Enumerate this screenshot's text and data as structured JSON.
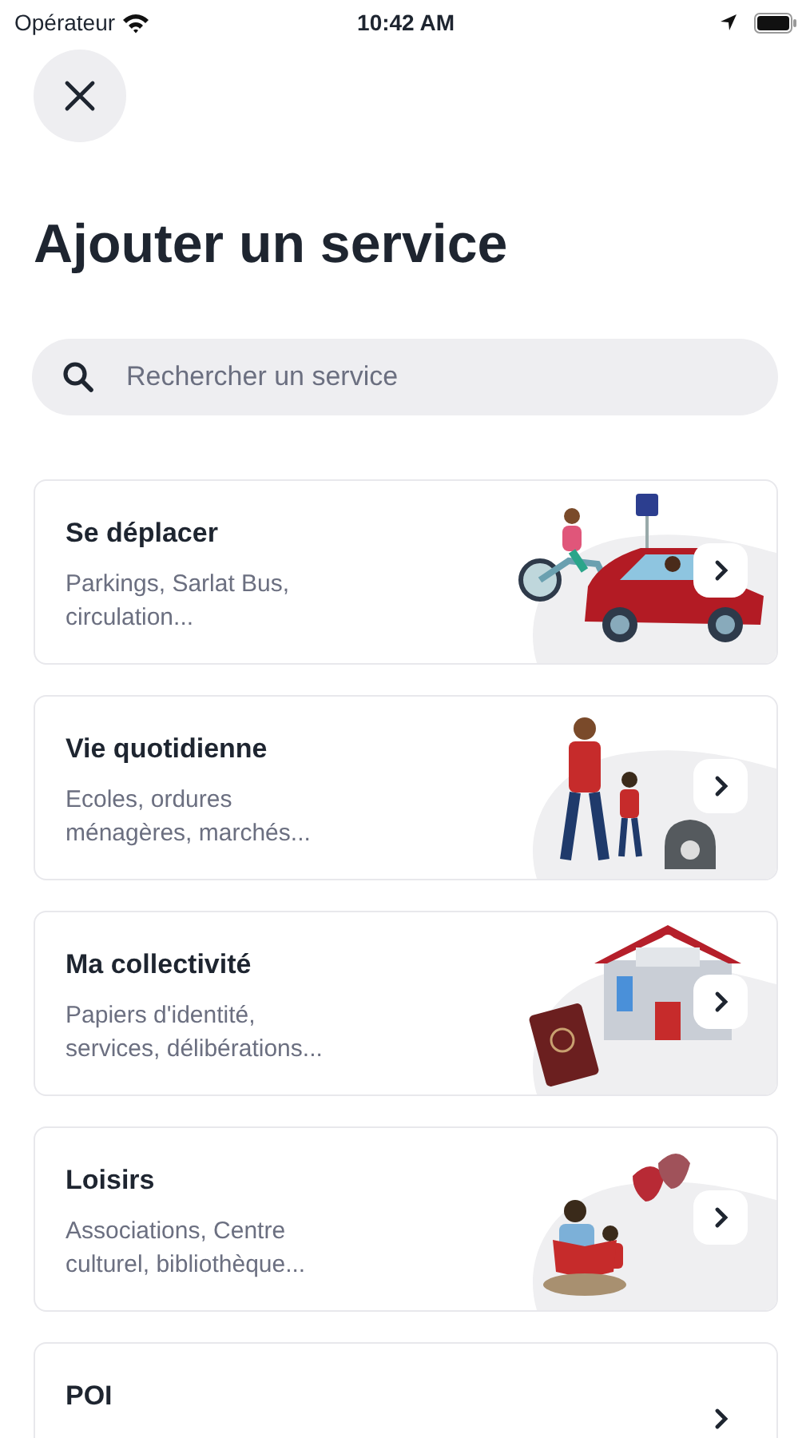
{
  "status_bar": {
    "carrier": "Opérateur",
    "time": "10:42 AM"
  },
  "title": "Ajouter un service",
  "search": {
    "placeholder": "Rechercher un service"
  },
  "services": [
    {
      "title": "Se déplacer",
      "subtitle": "Parkings, Sarlat Bus, circulation...",
      "kind": "transport"
    },
    {
      "title": "Vie quotidienne",
      "subtitle": "Ecoles, ordures ménagères, marchés...",
      "kind": "daily"
    },
    {
      "title": "Ma collectivité",
      "subtitle": "Papiers d'identité, services, délibérations...",
      "kind": "town"
    },
    {
      "title": "Loisirs",
      "subtitle": "Associations, Centre culturel, bibliothèque...",
      "kind": "leisure"
    },
    {
      "title": "POI",
      "kind": "plain"
    }
  ]
}
